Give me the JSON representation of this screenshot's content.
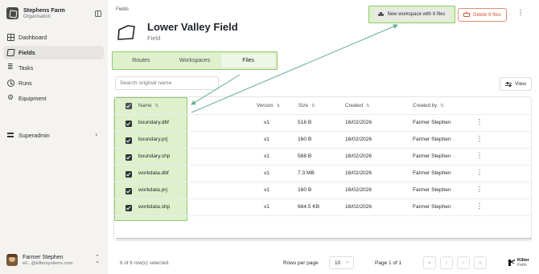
{
  "sidebar": {
    "org_name": "Stephens Farm",
    "org_type": "Organisation",
    "items": [
      {
        "label": "Dashboard",
        "icon": "grid-icon",
        "active": false
      },
      {
        "label": "Fields",
        "icon": "field-icon",
        "active": true
      },
      {
        "label": "Tasks",
        "icon": "tasks-icon",
        "active": false
      },
      {
        "label": "Runs",
        "icon": "clock-icon",
        "active": false
      },
      {
        "label": "Equipment",
        "icon": "gear-icon",
        "active": false
      }
    ],
    "superadmin_label": "Superadmin",
    "user": {
      "name": "Farmer Stephen",
      "email": "eli...@kiltersystems.com"
    }
  },
  "main": {
    "breadcrumb": "Fields",
    "title": "Lower Valley Field",
    "subtitle": "Field",
    "new_workspace_label": "New workspace with 6 files",
    "delete_label": "Delete 6 files",
    "tabs": [
      {
        "label": "Routes",
        "active": false
      },
      {
        "label": "Workspaces",
        "active": false
      },
      {
        "label": "Files",
        "active": true
      }
    ],
    "search_placeholder": "Search original name",
    "view_label": "View"
  },
  "table": {
    "columns": [
      "Name",
      "Version",
      "Size",
      "Created",
      "Created by"
    ],
    "rows": [
      {
        "name": "boundary.dbf",
        "version": "v1",
        "size": "516 B",
        "created": "16/02/2026",
        "created_by": "Farmer Stephen",
        "selected": true
      },
      {
        "name": "boundary.prj",
        "version": "v1",
        "size": "160 B",
        "created": "16/02/2026",
        "created_by": "Farmer Stephen",
        "selected": true
      },
      {
        "name": "boundary.shp",
        "version": "v1",
        "size": "588 B",
        "created": "16/02/2026",
        "created_by": "Farmer Stephen",
        "selected": true
      },
      {
        "name": "workdata.dbf",
        "version": "v1",
        "size": "7.3 MB",
        "created": "16/02/2026",
        "created_by": "Farmer Stephen",
        "selected": true
      },
      {
        "name": "workdata.prj",
        "version": "v1",
        "size": "160 B",
        "created": "16/02/2026",
        "created_by": "Farmer Stephen",
        "selected": true
      },
      {
        "name": "workdata.shp",
        "version": "v1",
        "size": "684.5 KB",
        "created": "16/02/2026",
        "created_by": "Farmer Stephen",
        "selected": true
      }
    ]
  },
  "footer": {
    "selection_text": "6 of 6 row(s) selected.",
    "rows_per_page_label": "Rows per page",
    "rows_per_page_value": "10",
    "page_label": "Page 1 of 1"
  },
  "brand": {
    "name": "Kilter",
    "sub": "Farm"
  },
  "colors": {
    "highlight_fill": "#dff0cd",
    "highlight_border": "#8fc870",
    "danger": "#d2553a",
    "arrow": "#5fb08a"
  }
}
